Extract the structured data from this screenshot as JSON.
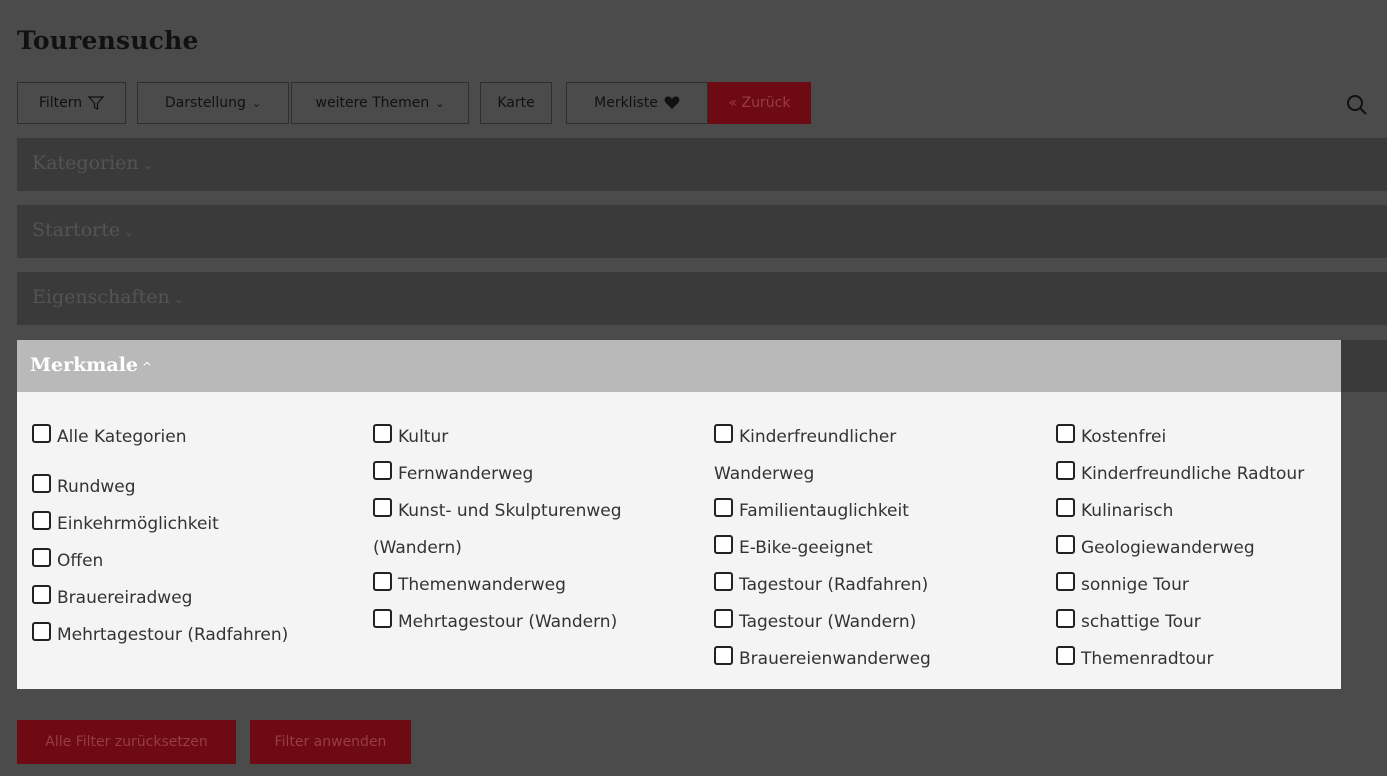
{
  "page_title": "Tourensuche",
  "toolbar": {
    "filter": "Filtern",
    "display": "Darstellung",
    "themes": "weitere Themen",
    "map": "Karte",
    "watchlist": "Merkliste",
    "back": "« Zurück"
  },
  "panels": {
    "categories": "Kategorien",
    "start_places": "Startorte",
    "properties": "Eigenschaften",
    "features": "Merkmale"
  },
  "features": {
    "col1": [
      "Alle Kategorien",
      "Rundweg",
      "Einkehrmöglichkeit",
      "Offen",
      "Brauereiradweg",
      "Mehrtagestour (Radfahren)"
    ],
    "col2": [
      "Kultur",
      "Fernwanderweg",
      "Kunst- und Skulpturenweg (Wandern)",
      "Themenwanderweg",
      "Mehrtagestour (Wandern)"
    ],
    "col3": [
      "Kinderfreundlicher Wanderweg",
      "Familientauglichkeit",
      "E-Bike-geeignet",
      "Tagestour (Radfahren)",
      "Tagestour (Wandern)",
      "Brauereienwanderweg"
    ],
    "col4": [
      "Kostenfrei",
      "Kinderfreundliche Radtour",
      "Kulinarisch",
      "Geologiewanderweg",
      "sonnige Tour",
      "schattige Tour",
      "Themenradtour"
    ]
  },
  "actions": {
    "reset": "Alle Filter zurücksetzen",
    "apply": "Filter anwenden"
  }
}
